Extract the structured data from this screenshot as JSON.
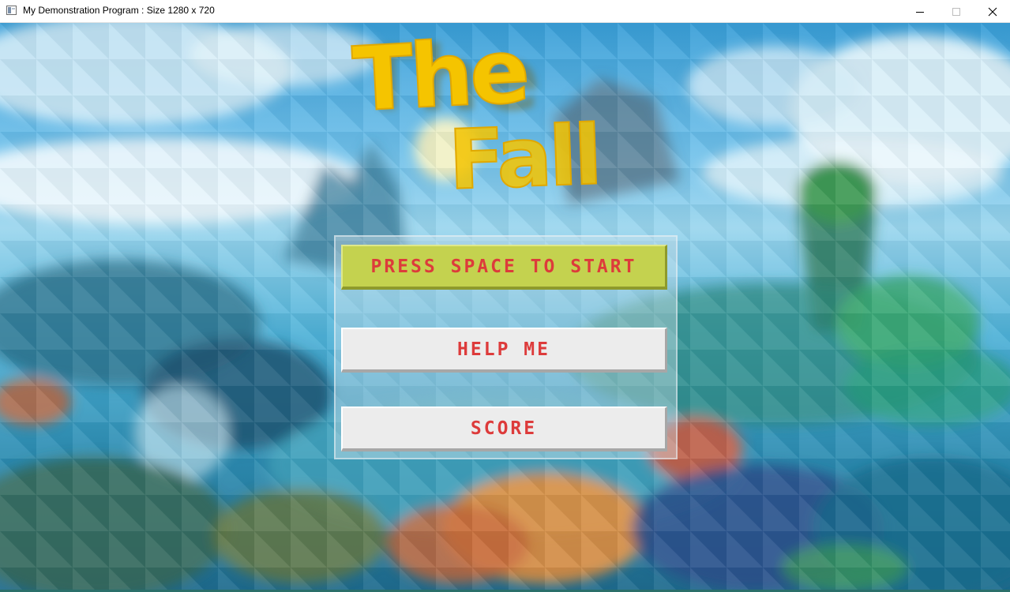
{
  "window": {
    "title": "My Demonstration Program : Size 1280 x 720",
    "icon": "app-window-icon",
    "controls": [
      "minimize-icon",
      "maximize-icon",
      "close-icon"
    ]
  },
  "game": {
    "logo_text": [
      "The",
      "Fall"
    ],
    "logo_color": "#f5c400",
    "menu": {
      "start_label": "PRESS SPACE TO START",
      "help_label": "HELP ME",
      "score_label": "SCORE",
      "label_color": "#dd3b3b",
      "start_bg": "#c4d24f",
      "button_bg": "#ececec"
    }
  }
}
